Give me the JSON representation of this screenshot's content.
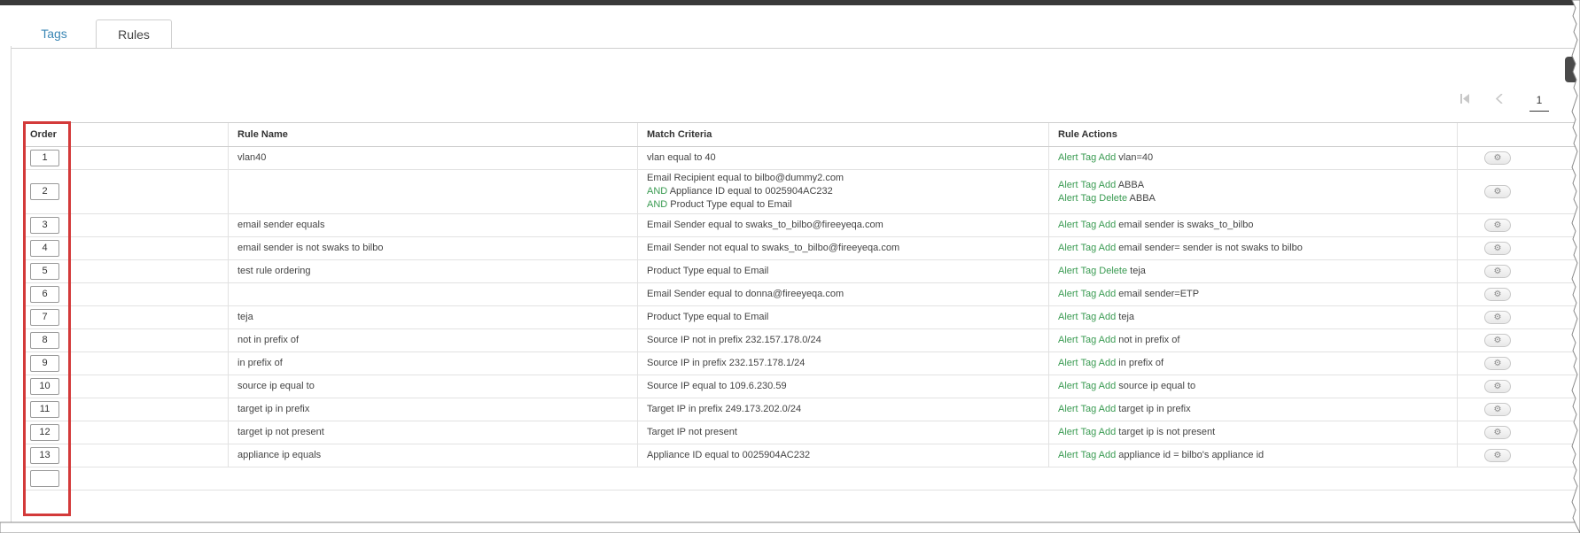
{
  "tabs": [
    {
      "label": "Tags",
      "active": false
    },
    {
      "label": "Rules",
      "active": true
    }
  ],
  "pager": {
    "first_icon": "first-page-icon",
    "prev_icon": "prev-page-icon",
    "current_page": "1"
  },
  "table": {
    "headers": {
      "order": "Order",
      "rule_name": "Rule Name",
      "match_criteria": "Match Criteria",
      "rule_actions": "Rule Actions"
    },
    "rows": [
      {
        "order": "1",
        "name": "vlan40",
        "criteria": [
          {
            "prefix": "",
            "text": "vlan equal to 40"
          }
        ],
        "actions": [
          {
            "verb": "Alert Tag Add",
            "value": "vlan=40"
          }
        ]
      },
      {
        "order": "2",
        "name": "",
        "criteria": [
          {
            "prefix": "",
            "text": "Email Recipient equal to bilbo@dummy2.com"
          },
          {
            "prefix": "AND",
            "text": "Appliance ID equal to 0025904AC232"
          },
          {
            "prefix": "AND",
            "text": "Product Type equal to Email"
          }
        ],
        "actions": [
          {
            "verb": "Alert Tag Add",
            "value": "ABBA"
          },
          {
            "verb": "Alert Tag Delete",
            "value": "ABBA"
          }
        ]
      },
      {
        "order": "3",
        "name": "email sender equals",
        "criteria": [
          {
            "prefix": "",
            "text": "Email Sender equal to swaks_to_bilbo@fireeyeqa.com"
          }
        ],
        "actions": [
          {
            "verb": "Alert Tag Add",
            "value": "email sender is swaks_to_bilbo"
          }
        ]
      },
      {
        "order": "4",
        "name": "email sender is not swaks to bilbo",
        "criteria": [
          {
            "prefix": "",
            "text": "Email Sender not equal to swaks_to_bilbo@fireeyeqa.com"
          }
        ],
        "actions": [
          {
            "verb": "Alert Tag Add",
            "value": "email sender= sender is not swaks to bilbo"
          }
        ]
      },
      {
        "order": "5",
        "name": "test rule ordering",
        "criteria": [
          {
            "prefix": "",
            "text": "Product Type equal to Email"
          }
        ],
        "actions": [
          {
            "verb": "Alert Tag Delete",
            "value": "teja"
          }
        ]
      },
      {
        "order": "6",
        "name": "",
        "criteria": [
          {
            "prefix": "",
            "text": "Email Sender equal to donna@fireeyeqa.com"
          }
        ],
        "actions": [
          {
            "verb": "Alert Tag Add",
            "value": "email sender=ETP"
          }
        ]
      },
      {
        "order": "7",
        "name": "teja",
        "criteria": [
          {
            "prefix": "",
            "text": "Product Type equal to Email"
          }
        ],
        "actions": [
          {
            "verb": "Alert Tag Add",
            "value": "teja"
          }
        ]
      },
      {
        "order": "8",
        "name": "not in prefix of",
        "criteria": [
          {
            "prefix": "",
            "text": "Source IP not in prefix 232.157.178.0/24"
          }
        ],
        "actions": [
          {
            "verb": "Alert Tag Add",
            "value": "not in prefix of"
          }
        ]
      },
      {
        "order": "9",
        "name": "in prefix of",
        "criteria": [
          {
            "prefix": "",
            "text": "Source IP in prefix 232.157.178.1/24"
          }
        ],
        "actions": [
          {
            "verb": "Alert Tag Add",
            "value": "in prefix of"
          }
        ]
      },
      {
        "order": "10",
        "name": "source ip equal to",
        "criteria": [
          {
            "prefix": "",
            "text": "Source IP equal to 109.6.230.59"
          }
        ],
        "actions": [
          {
            "verb": "Alert Tag Add",
            "value": "source ip equal to"
          }
        ]
      },
      {
        "order": "11",
        "name": "target ip in prefix",
        "criteria": [
          {
            "prefix": "",
            "text": "Target IP in prefix 249.173.202.0/24"
          }
        ],
        "actions": [
          {
            "verb": "Alert Tag Add",
            "value": "target ip in prefix"
          }
        ]
      },
      {
        "order": "12",
        "name": "target ip not present",
        "criteria": [
          {
            "prefix": "",
            "text": "Target IP not present"
          }
        ],
        "actions": [
          {
            "verb": "Alert Tag Add",
            "value": "target ip is not present"
          }
        ]
      },
      {
        "order": "13",
        "name": "appliance ip equals",
        "criteria": [
          {
            "prefix": "",
            "text": "Appliance ID equal to 0025904AC232"
          }
        ],
        "actions": [
          {
            "verb": "Alert Tag Add",
            "value": "appliance id = bilbo's appliance id"
          }
        ]
      }
    ],
    "row_action_icon": "gear-icon"
  },
  "colors": {
    "accent_link": "#3b87b5",
    "action_green": "#3a9b52",
    "highlight_red": "#d33a3a",
    "top_bar": "#3a3a3a"
  }
}
